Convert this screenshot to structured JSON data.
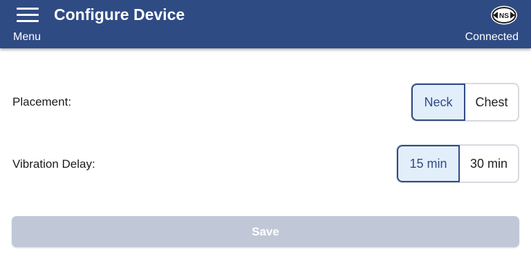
{
  "header": {
    "title": "Configure Device",
    "menu_label": "Menu",
    "status": "Connected",
    "logo_text": "NS",
    "background": "#2f4b84"
  },
  "settings": {
    "placement": {
      "label": "Placement:",
      "options": [
        "Neck",
        "Chest"
      ],
      "selected": "Neck"
    },
    "vibration_delay": {
      "label": "Vibration Delay:",
      "options": [
        "15 min",
        "30 min"
      ],
      "selected": "15 min"
    }
  },
  "actions": {
    "save_label": "Save",
    "save_enabled": false
  },
  "colors": {
    "accent": "#2f4b84",
    "selected_bg": "#e3eefb",
    "disabled_button": "#c0c8d8"
  },
  "icons": {
    "menu": "hamburger-menu-icon",
    "logo": "ns-logo-icon"
  }
}
